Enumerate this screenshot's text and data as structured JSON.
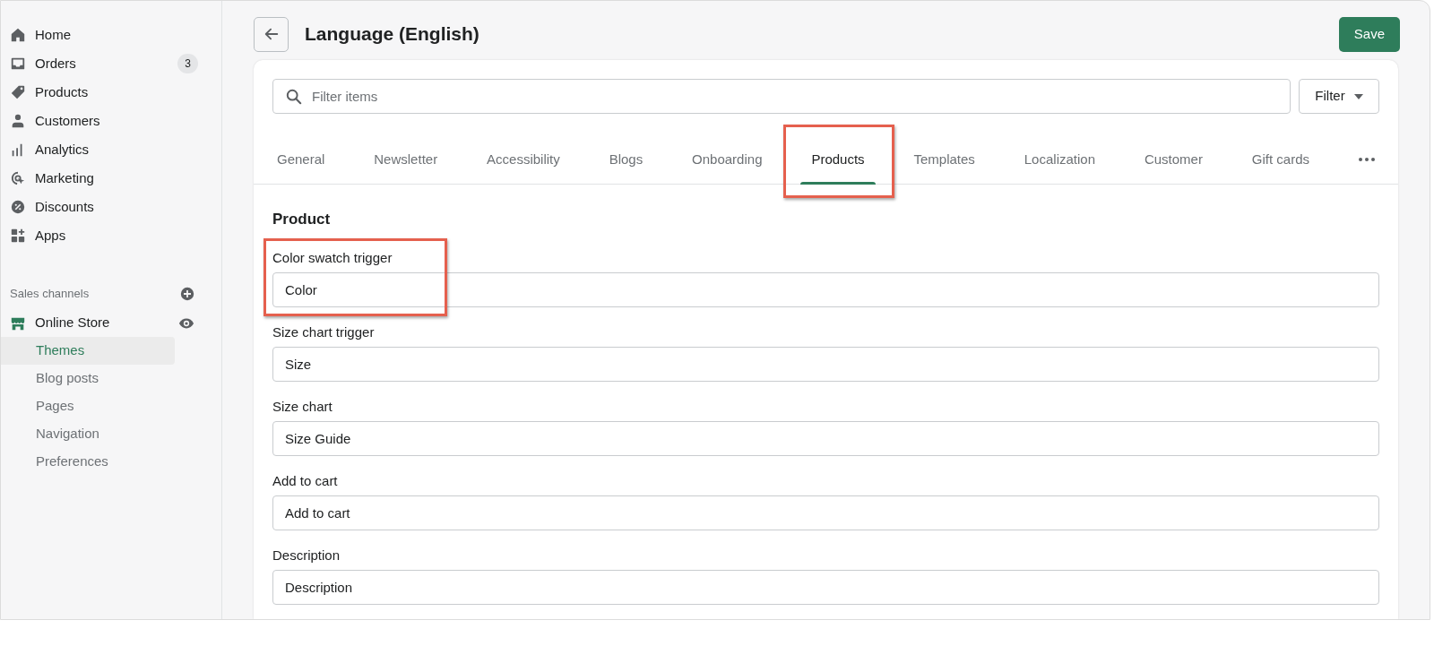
{
  "sidebar": {
    "nav": [
      {
        "label": "Home"
      },
      {
        "label": "Orders",
        "badge": "3"
      },
      {
        "label": "Products"
      },
      {
        "label": "Customers"
      },
      {
        "label": "Analytics"
      },
      {
        "label": "Marketing"
      },
      {
        "label": "Discounts"
      },
      {
        "label": "Apps"
      }
    ],
    "sales_channels": {
      "heading": "Sales channels",
      "channel": {
        "label": "Online Store"
      },
      "subitems": [
        {
          "label": "Themes",
          "selected": true
        },
        {
          "label": "Blog posts",
          "selected": false
        },
        {
          "label": "Pages",
          "selected": false
        },
        {
          "label": "Navigation",
          "selected": false
        },
        {
          "label": "Preferences",
          "selected": false
        }
      ]
    }
  },
  "header": {
    "title": "Language (English)",
    "save_button": "Save"
  },
  "search": {
    "placeholder": "Filter items"
  },
  "filter_button": "Filter",
  "tabs": [
    {
      "label": "General",
      "selected": false,
      "highlighted": false
    },
    {
      "label": "Newsletter",
      "selected": false,
      "highlighted": false
    },
    {
      "label": "Accessibility",
      "selected": false,
      "highlighted": false
    },
    {
      "label": "Blogs",
      "selected": false,
      "highlighted": false
    },
    {
      "label": "Onboarding",
      "selected": false,
      "highlighted": false
    },
    {
      "label": "Products",
      "selected": true,
      "highlighted": true
    },
    {
      "label": "Templates",
      "selected": false,
      "highlighted": false
    },
    {
      "label": "Localization",
      "selected": false,
      "highlighted": false
    },
    {
      "label": "Customer",
      "selected": false,
      "highlighted": false
    },
    {
      "label": "Gift cards",
      "selected": false,
      "highlighted": false
    }
  ],
  "section": {
    "heading": "Product",
    "fields": [
      {
        "label": "Color swatch trigger",
        "value": "Color",
        "highlighted": true
      },
      {
        "label": "Size chart trigger",
        "value": "Size",
        "highlighted": false
      },
      {
        "label": "Size chart",
        "value": "Size Guide",
        "highlighted": false
      },
      {
        "label": "Add to cart",
        "value": "Add to cart",
        "highlighted": false
      },
      {
        "label": "Description",
        "value": "Description",
        "highlighted": false
      }
    ]
  }
}
